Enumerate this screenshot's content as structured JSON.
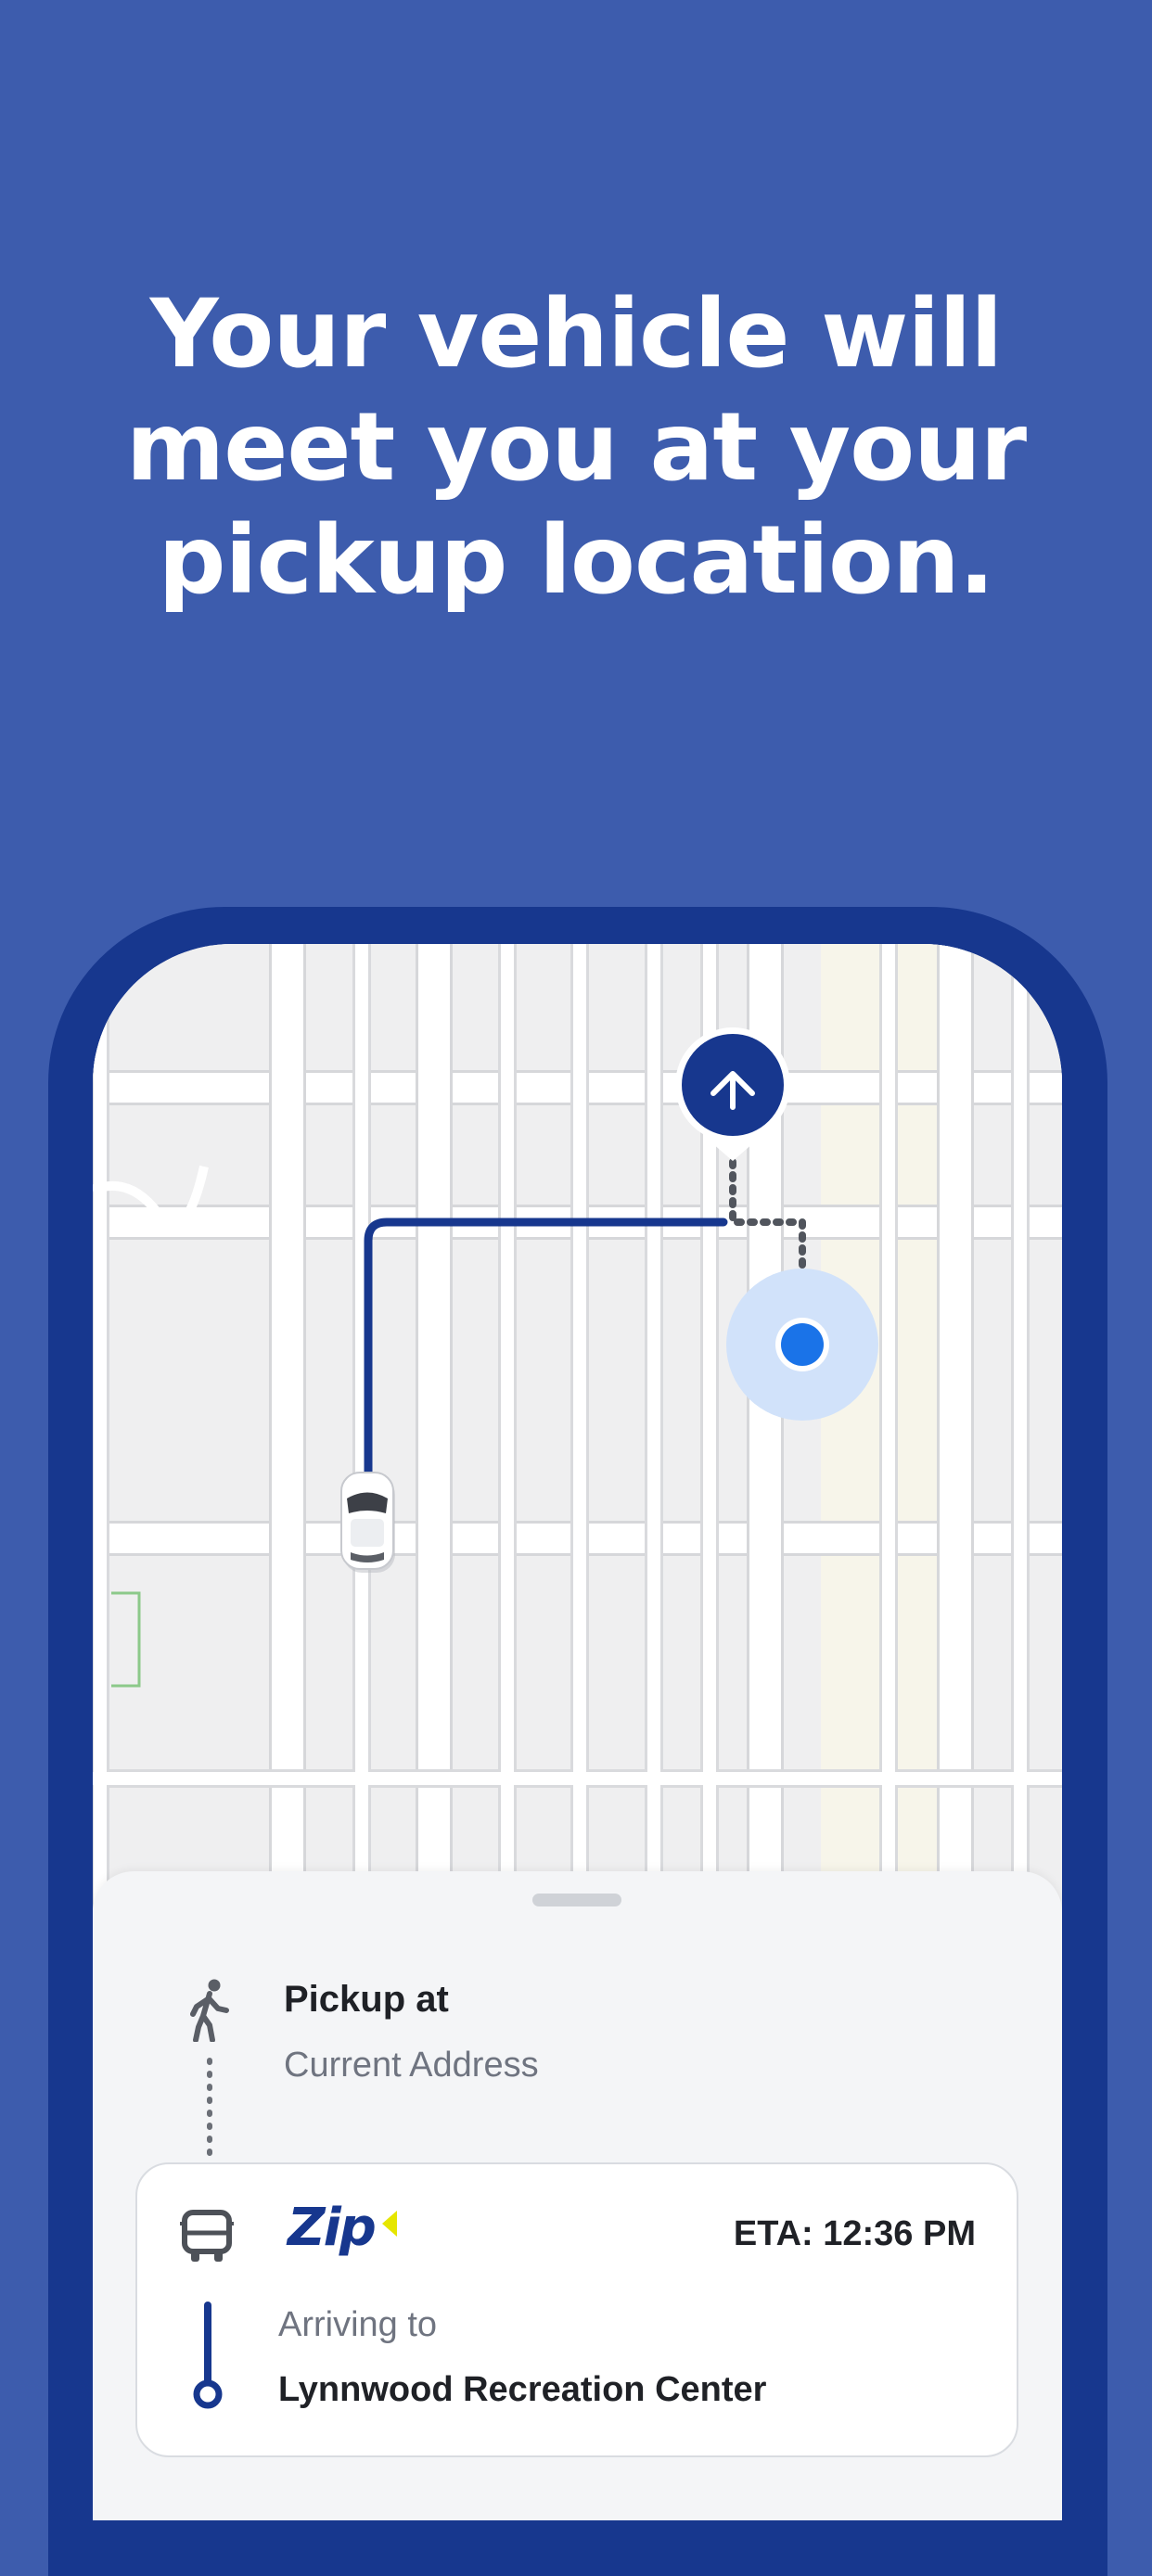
{
  "headline": {
    "line1": "Your vehicle will",
    "line2": "meet you at your",
    "line3": "pickup location."
  },
  "map": {
    "route_color": "#17378e",
    "user_dot_color": "#1a73e8",
    "destination_icon": "arrow-up-icon",
    "vehicle_icon": "car-icon"
  },
  "pickup": {
    "icon": "walking-person-icon",
    "title": "Pickup at",
    "address": "Current Address"
  },
  "ride": {
    "vehicle_icon": "bus-icon",
    "brand": "Zip",
    "brand_color": "#17378e",
    "brand_accent": "#e6e600",
    "eta": "ETA: 12:36 PM",
    "arriving_label": "Arriving to",
    "destination": "Lynnwood Recreation Center"
  }
}
